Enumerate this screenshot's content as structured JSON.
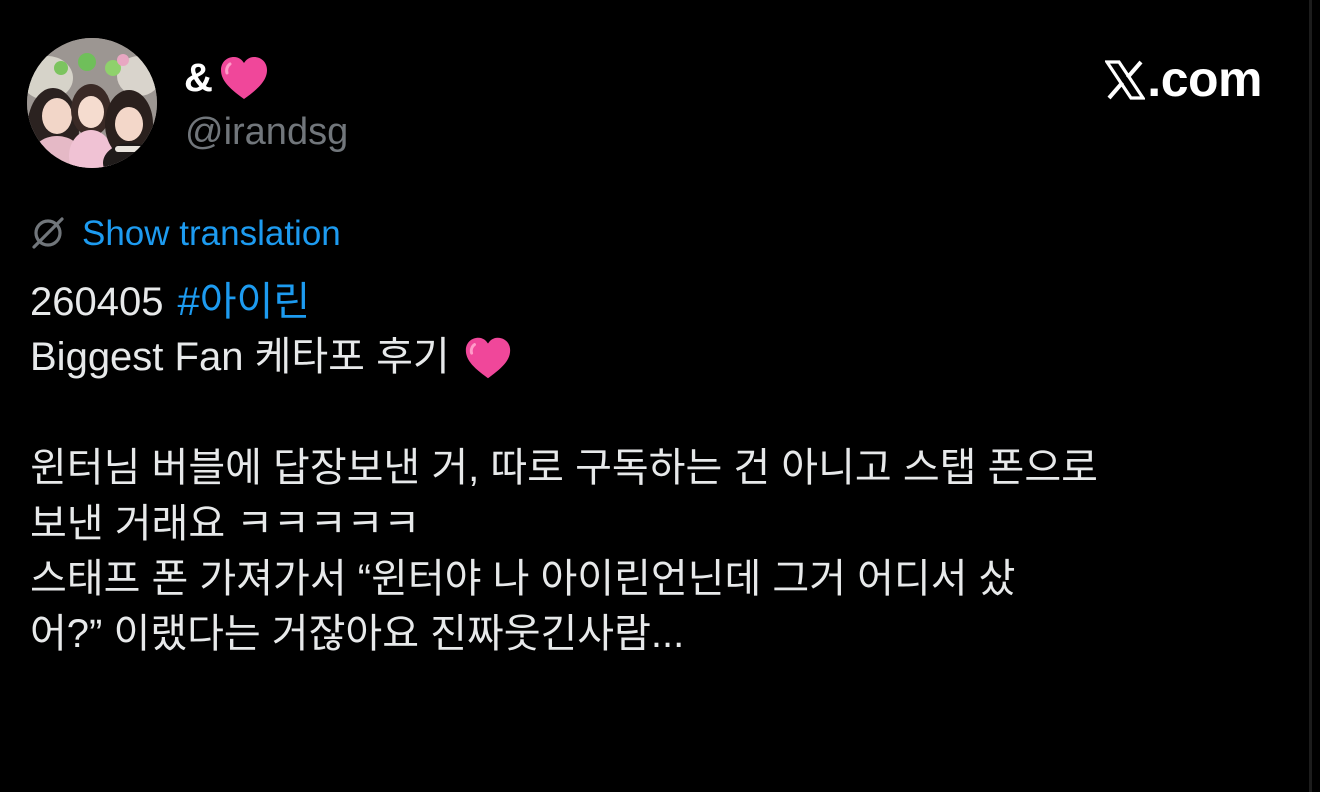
{
  "profile": {
    "display_name": "&",
    "display_name_emoji": "pink-heart-emoji",
    "handle": "@irandsg",
    "avatar": "group-photo-avatar"
  },
  "brand": {
    "text": ".com",
    "logo": "x-logo"
  },
  "translation": {
    "icon": "globe-slash-icon",
    "label": "Show translation"
  },
  "tweet": {
    "date": "260405",
    "hashtag": "#아이린",
    "title": "Biggest Fan 케타포 후기",
    "title_emoji": "pink-heart-emoji",
    "lines": [
      "윈터님 버블에 답장보낸 거, 따로 구독하는 건 아니고 스탭 폰으로",
      "보낸 거래요 ㅋㅋㅋㅋㅋ",
      "스태프 폰 가져가서 “윈터야 나 아이린언닌데 그거 어디서 샀",
      "어?” 이랬다는 거잖아요 진짜웃긴사람..."
    ]
  },
  "colors": {
    "background": "#000000",
    "text": "#e7e9ea",
    "muted": "#71767b",
    "link": "#1d9bf0",
    "heart": "#f0479a"
  }
}
